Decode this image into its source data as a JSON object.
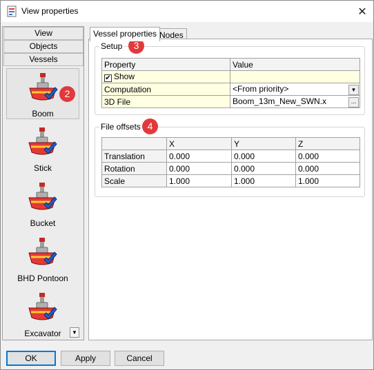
{
  "window": {
    "title": "View properties"
  },
  "left_panel": {
    "categories": [
      "View",
      "Objects",
      "Vessels"
    ],
    "vessels": [
      "Boom",
      "Stick",
      "Bucket",
      "BHD Pontoon",
      "Excavator"
    ],
    "selected_vessel": "Boom"
  },
  "badges": [
    "2",
    "3",
    "4"
  ],
  "tabs": [
    "Vessel properties",
    "Nodes"
  ],
  "setup": {
    "label": "Setup",
    "headers": [
      "Property",
      "Value"
    ],
    "rows": [
      {
        "property": "Show",
        "value": "",
        "checked": true
      },
      {
        "property": "Computation",
        "value": "<From priority>"
      },
      {
        "property": "3D File",
        "value": "Boom_13m_New_SWN.x"
      }
    ],
    "dropdown_symbol": "▼",
    "browse_symbol": "..."
  },
  "file_offsets": {
    "label": "File offsets",
    "headers": [
      "X",
      "Y",
      "Z"
    ],
    "rows": [
      {
        "label": "Translation",
        "values": [
          "0.000",
          "0.000",
          "0.000"
        ]
      },
      {
        "label": "Rotation",
        "values": [
          "0.000",
          "0.000",
          "0.000"
        ]
      },
      {
        "label": "Scale",
        "values": [
          "1.000",
          "1.000",
          "1.000"
        ]
      }
    ]
  },
  "buttons": {
    "ok": "OK",
    "apply": "Apply",
    "cancel": "Cancel"
  },
  "icons": {
    "app": "document-properties-icon",
    "close": "close-icon",
    "vessel": "boat-check-icon",
    "checkmark": "checkmark-icon"
  },
  "colors": {
    "badge": "#e2393c",
    "accent": "#0078d7",
    "yellow_cell": "#ffffe1"
  }
}
